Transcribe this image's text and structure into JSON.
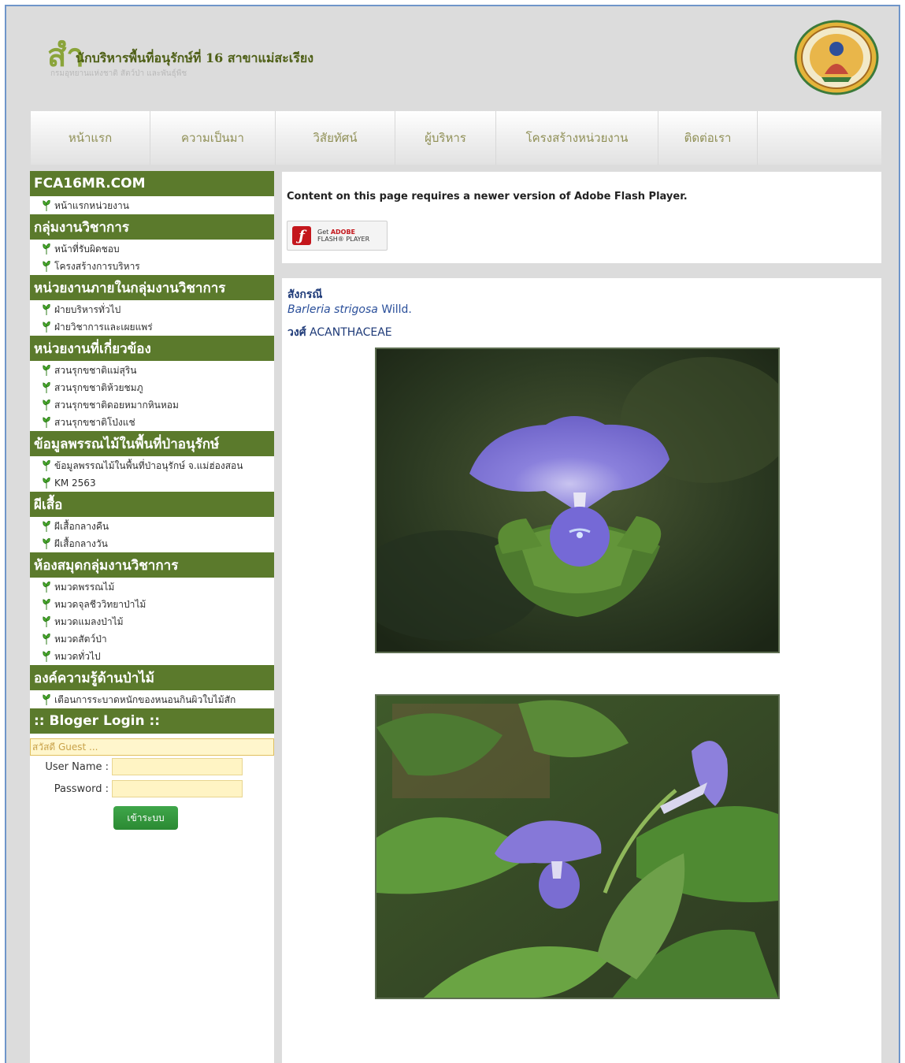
{
  "header": {
    "logo_char": "สำ",
    "title": "นักบริหารพื้นที่อนุรักษ์ที่ 16 สาขาแม่สะเรียง",
    "subtitle": "กรมอุทยานแห่งชาติ สัตว์ป่า และพันธุ์พืช"
  },
  "nav": {
    "items": [
      {
        "label": "หน้าแรก"
      },
      {
        "label": "ความเป็นมา"
      },
      {
        "label": "วิสัยทัศน์"
      },
      {
        "label": "ผู้บริหาร"
      },
      {
        "label": "โครงสร้างหน่วยงาน"
      },
      {
        "label": "ติดต่อเรา"
      }
    ]
  },
  "sidebar": {
    "sections": [
      {
        "title": "FCA16MR.COM",
        "links": [
          "หน้าแรกหน่วยงาน"
        ]
      },
      {
        "title": "กลุ่มงานวิชาการ",
        "links": [
          "หน้าที่รับผิดชอบ",
          "โครงสร้างการบริหาร"
        ]
      },
      {
        "title": "หน่วยงานภายในกลุ่มงานวิชาการ",
        "links": [
          "ฝ่ายบริหารทั่วไป",
          "ฝ่ายวิชาการและเผยแพร่"
        ]
      },
      {
        "title": "หน่วยงานที่เกี่ยวข้อง",
        "links": [
          "สวนรุกขชาติแม่สุริน",
          "สวนรุกขชาติห้วยชมภู",
          "สวนรุกขชาติดอยหมากหินหอม",
          "สวนรุกขชาติโป่งแช่"
        ]
      },
      {
        "title": "ข้อมูลพรรณไม้ในพื้นที่ป่าอนุรักษ์",
        "links": [
          "ข้อมูลพรรณไม้ในพื้นที่ป่าอนุรักษ์ จ.แม่ฮ่องสอน",
          "KM 2563"
        ]
      },
      {
        "title": "ผีเสื้อ",
        "links": [
          "ผีเสื้อกลางคืน",
          "ผีเสื้อกลางวัน"
        ]
      },
      {
        "title": "ห้องสมุดกลุ่มงานวิชาการ",
        "links": [
          "หมวดพรรณไม้",
          "หมวดจุลชีววิทยาป่าไม้",
          "หมวดแมลงป่าไม้",
          "หมวดสัตว์ป่า",
          "หมวดทั่วไป"
        ]
      },
      {
        "title": "องค์ความรู้ด้านป่าไม้",
        "links": [
          "เตือนการระบาดหนักของหนอนกินผิวใบไม้สัก"
        ]
      }
    ],
    "login": {
      "title": ":: Bloger Login ::",
      "greeting": "สวัสดี Guest ...",
      "username_label": "User Name :",
      "password_label": "Password :",
      "button": "เข้าระบบ"
    }
  },
  "flash": {
    "message": "Content on this page requires a newer version of Adobe Flash Player.",
    "get_label": "Get",
    "adobe_label": "ADOBE",
    "player_label": "FLASH® PLAYER"
  },
  "content": {
    "thai_name": "สังกรณี",
    "genus_species": "Barleria strigosa",
    "author": "Willd.",
    "family_label": "วงศ์",
    "family": "ACANTHACEAE"
  },
  "colors": {
    "sidebar_header": "#5b7a2c",
    "flower": "#7b72d6",
    "frame_border": "#6f95c9"
  }
}
